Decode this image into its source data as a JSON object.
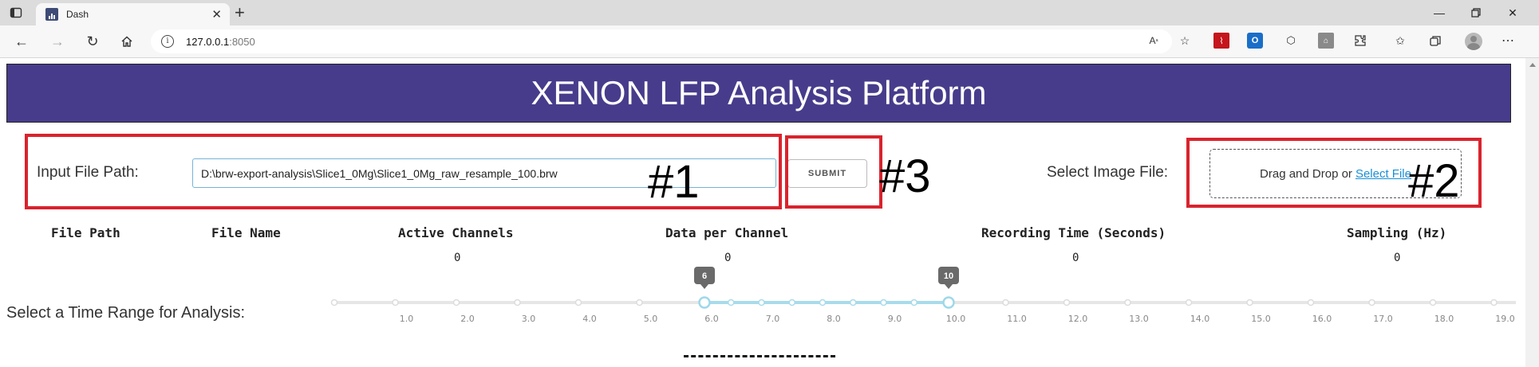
{
  "browser": {
    "tab_title": "Dash",
    "url_host": "127.0.0.1",
    "url_port": ":8050"
  },
  "page": {
    "banner_title": "XENON LFP Analysis Platform",
    "input_label": "Input File Path:",
    "input_value": "D:\\brw-export-analysis\\Slice1_0Mg\\Slice1_0Mg_raw_resample_100.brw",
    "submit_label": "SUBMIT",
    "image_label": "Select Image File:",
    "dropzone_text": "Drag and Drop or",
    "dropzone_link": "Select File",
    "annotations": {
      "a1": "#1",
      "a2": "#2",
      "a3": "#3"
    },
    "info_headers": [
      "File Path",
      "File Name",
      "Active Channels",
      "Data per Channel",
      "Recording Time (Seconds)",
      "Sampling (Hz)"
    ],
    "info_values": {
      "active_channels": "0",
      "data_per_channel": "0",
      "recording_time": "0",
      "sampling": "0"
    },
    "slider_label": "Select a Time Range for Analysis:",
    "slider": {
      "min": 0,
      "max": 19,
      "value_low": 6,
      "value_high": 10,
      "handle_low_label": "6",
      "handle_high_label": "10",
      "tick_labels": [
        "1.0",
        "2.0",
        "3.0",
        "4.0",
        "5.0",
        "6.0",
        "7.0",
        "8.0",
        "9.0",
        "10.0",
        "11.0",
        "12.0",
        "13.0",
        "14.0",
        "15.0",
        "16.0",
        "17.0",
        "18.0",
        "19.0"
      ]
    }
  },
  "colors": {
    "banner": "#473c8b",
    "annotation_box": "#d9232d",
    "slider_track": "#e6e6e6",
    "slider_active": "#a8dbeb",
    "slider_handle": "#9fd8ea",
    "tooltip": "#6a6a6a"
  }
}
